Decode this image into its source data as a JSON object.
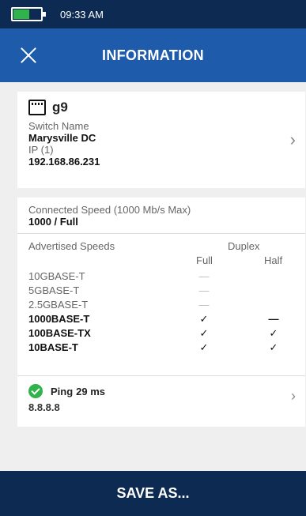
{
  "status_bar": {
    "time": "09:33 AM",
    "battery_level": 0.55,
    "battery_color": "#2fb34a"
  },
  "app_bar": {
    "title": "INFORMATION",
    "close_icon": "close-icon",
    "color": "#1e5cab"
  },
  "switch_card": {
    "icon": "ethernet-port-icon",
    "name": "g9",
    "switch_name_label": "Switch Name",
    "switch_name_value": "Marysville DC",
    "ip_label": "IP (1)",
    "ip_value": "192.168.86.231",
    "chevron": "›"
  },
  "speed_card": {
    "connected_label": "Connected Speed (1000 Mb/s Max)",
    "connected_value": "1000 / Full",
    "advertised_label": "Advertised Speeds",
    "duplex_label": "Duplex",
    "full_label": "Full",
    "half_label": "Half",
    "rows": [
      {
        "name": "10GBASE-T",
        "full": "—",
        "half": ""
      },
      {
        "name": "5GBASE-T",
        "full": "—",
        "half": ""
      },
      {
        "name": "2.5GBASE-T",
        "full": "—",
        "half": ""
      },
      {
        "name": "1000BASE-T",
        "full": "✓",
        "half": "—"
      },
      {
        "name": "100BASE-TX",
        "full": "✓",
        "half": "✓"
      },
      {
        "name": "10BASE-T",
        "full": "✓",
        "half": "✓"
      }
    ]
  },
  "ping": {
    "label": "Ping",
    "value": "29 ms",
    "address": "8.8.8.8",
    "chevron": "›",
    "status_color": "#2fb34a"
  },
  "save_bar": {
    "label": "SAVE AS..."
  }
}
